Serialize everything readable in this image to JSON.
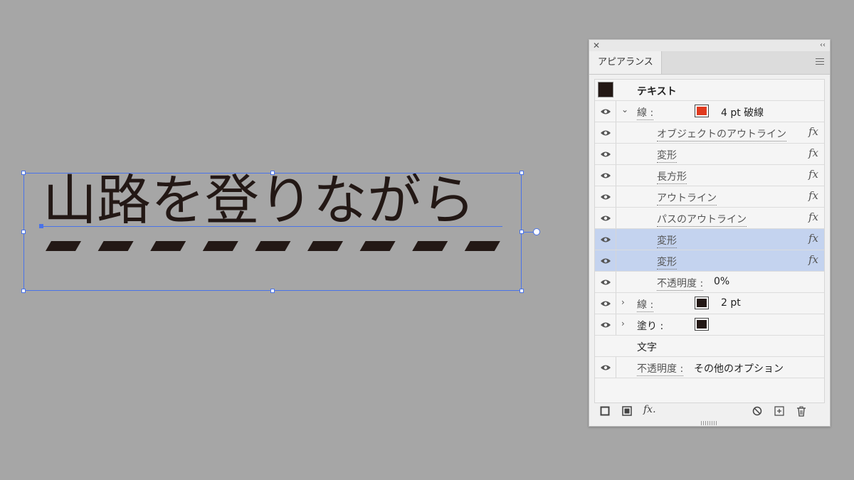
{
  "canvas": {
    "text": "山路を登りながら",
    "text_color": "#231815",
    "selection_color": "#4a73e8"
  },
  "panel": {
    "tab_label": "アピアランス",
    "close_icon": "close-icon",
    "collapse_icon": "collapse-icon",
    "menu_icon": "menu-icon",
    "header_title": "テキスト",
    "rows": [
      {
        "id": "stroke1",
        "label": "線",
        "value": "4 pt 破線",
        "swatch": "#e03a1e",
        "expanded": true
      },
      {
        "id": "fx1",
        "label": "オブジェクトのアウトライン",
        "fx": "fx"
      },
      {
        "id": "fx2",
        "label": "変形",
        "fx": "fx"
      },
      {
        "id": "fx3",
        "label": "長方形",
        "fx": "fx"
      },
      {
        "id": "fx4",
        "label": "アウトライン",
        "fx": "fx"
      },
      {
        "id": "fx5",
        "label": "パスのアウトライン",
        "fx": "fx"
      },
      {
        "id": "fx6",
        "label": "変形",
        "fx": "fx",
        "selected": true
      },
      {
        "id": "fx7",
        "label": "変形",
        "fx": "fx",
        "selected": true
      },
      {
        "id": "opac1",
        "label": "不透明度",
        "value": "0%"
      },
      {
        "id": "stroke2",
        "label": "線",
        "value": "2 pt",
        "swatch": "#231815"
      },
      {
        "id": "fill",
        "label": "塗り",
        "swatch": "#231815"
      },
      {
        "id": "chars",
        "label": "文字"
      },
      {
        "id": "opac2",
        "label": "不透明度",
        "value": "その他のオプション"
      }
    ],
    "colon": ":",
    "footer_fx": "fx."
  }
}
